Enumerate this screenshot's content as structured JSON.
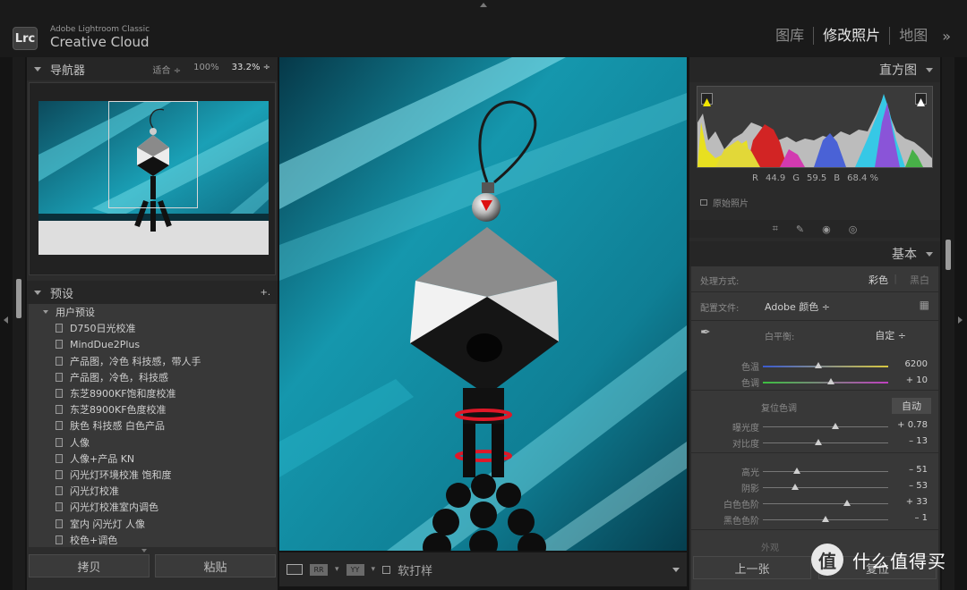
{
  "app": {
    "logo": "Lrc",
    "brand_line1": "Adobe Lightroom Classic",
    "brand_line2": "Creative Cloud"
  },
  "modules": [
    {
      "label": "图库",
      "active": false
    },
    {
      "label": "修改照片",
      "active": true
    },
    {
      "label": "地图",
      "active": false
    }
  ],
  "modules_more": "»",
  "navigator": {
    "title": "导航器",
    "fit": "适合 ÷",
    "zoom_100": "100%",
    "zoom_custom": "33.2% ÷"
  },
  "presets": {
    "title": "预设",
    "add": "+.",
    "folder": "用户预设",
    "items": [
      "D750日光校准",
      "MindDue2Plus",
      "产品图，冷色 科技感，带人手",
      "产品图，冷色，科技感",
      "东芝8900KF饱和度校准",
      "东芝8900KF色度校准",
      "肤色 科技感 白色产品",
      "人像",
      "人像+产品 KN",
      "闪光灯环境校准 饱和度",
      "闪光灯校准",
      "闪光灯校准室内调色",
      "室内 闪光灯 人像",
      "校色+调色"
    ]
  },
  "left_buttons": {
    "copy": "拷贝",
    "paste": "粘贴"
  },
  "toolbar": {
    "soft_proof": "软打样",
    "compare_ab": "YY"
  },
  "histogram": {
    "title": "直方图",
    "r_label": "R",
    "r_value": "44.9",
    "g_label": "G",
    "g_value": "59.5",
    "b_label": "B",
    "b_value": "68.4 %",
    "original_photo": "原始照片"
  },
  "basic": {
    "title": "基本",
    "treatment_label": "处理方式:",
    "treatment_color": "彩色",
    "treatment_bw": "黑白",
    "profile_label": "配置文件:",
    "profile_value": "Adobe 颜色 ÷",
    "wb_label": "白平衡:",
    "wb_value": "自定 ÷",
    "tone_label": "复位色调",
    "auto": "自动",
    "presence_label": "外观",
    "sliders": [
      {
        "label": "色温",
        "value": "6200",
        "pos": 0.44
      },
      {
        "label": "色调",
        "value": "+ 10",
        "pos": 0.54
      },
      {
        "label": "曝光度",
        "value": "+ 0.78",
        "pos": 0.58
      },
      {
        "label": "对比度",
        "value": "– 13",
        "pos": 0.44
      },
      {
        "label": "高光",
        "value": "– 51",
        "pos": 0.27
      },
      {
        "label": "阴影",
        "value": "– 53",
        "pos": 0.26
      },
      {
        "label": "白色色阶",
        "value": "+ 33",
        "pos": 0.67
      },
      {
        "label": "黑色色阶",
        "value": "– 1",
        "pos": 0.5
      }
    ]
  },
  "right_buttons": {
    "previous": "上一张",
    "reset": "复位"
  },
  "watermark": {
    "badge": "值",
    "text": "什么值得买"
  },
  "colors": {
    "accent_clip": "#f2e600",
    "photo_teal": "#1a9db0"
  }
}
